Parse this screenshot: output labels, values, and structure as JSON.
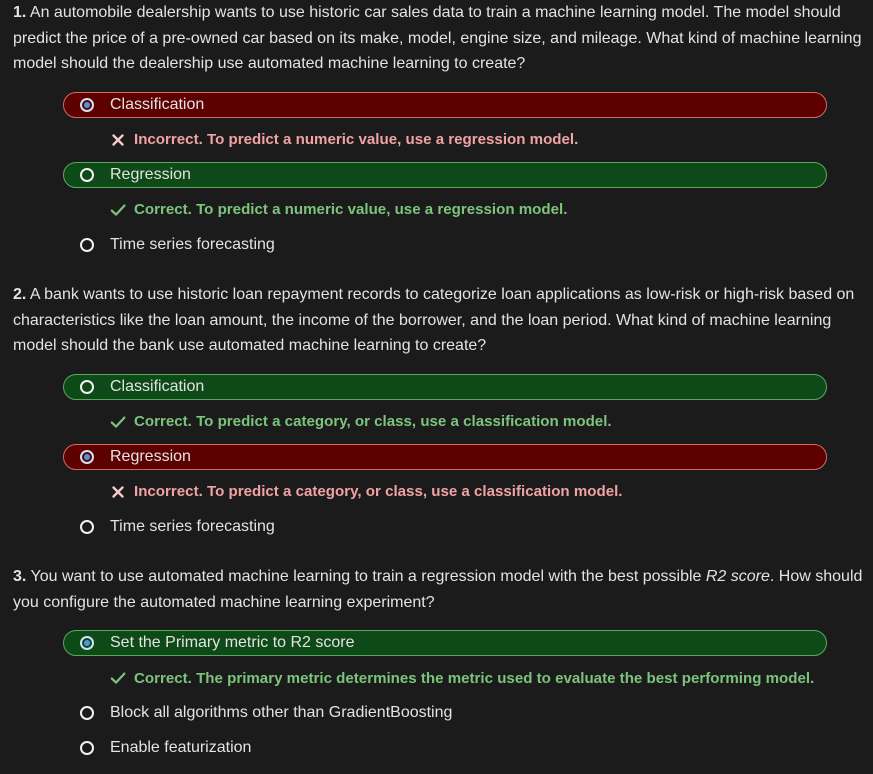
{
  "theme": {
    "page_bg": "#1b1b1b",
    "text": "#e3e3e3",
    "correct_fill": "#0d4a17",
    "correct_border": "#5aa85e",
    "correct_text": "#7cc47c",
    "incorrect_fill": "#5c0000",
    "incorrect_border": "#d06868",
    "incorrect_text": "#f1a3a3",
    "incorrect_icon": "#f6c9c9",
    "radio_ring": "#f2f2f2",
    "radio_selected_ring": "#cfe3f8",
    "radio_selected_dot": "#4e97e0"
  },
  "questions": [
    {
      "number": "1.",
      "text": "An automobile dealership wants to use historic car sales data to train a machine learning model. The model should predict the price of a pre-owned car based on its make, model, engine size, and mileage. What kind of machine learning model should the dealership use automated machine learning to create?",
      "choices": [
        {
          "label": "Classification",
          "selected": true,
          "result": "incorrect",
          "feedback_icon": "x-mark-icon",
          "feedback": "Incorrect. To predict a numeric value, use a regression model."
        },
        {
          "label": "Regression",
          "selected": false,
          "result": "correct",
          "feedback_icon": "checkmark-icon",
          "feedback": "Correct. To predict a numeric value, use a regression model."
        },
        {
          "label": "Time series forecasting",
          "selected": false
        }
      ]
    },
    {
      "number": "2.",
      "text": "A bank wants to use historic loan repayment records to categorize loan applications as low-risk or high-risk based on characteristics like the loan amount, the income of the borrower, and the loan period. What kind of machine learning model should the bank use automated machine learning to create?",
      "choices": [
        {
          "label": "Classification",
          "selected": false,
          "result": "correct",
          "feedback_icon": "checkmark-icon",
          "feedback": "Correct. To predict a category, or class, use a classification model."
        },
        {
          "label": "Regression",
          "selected": true,
          "result": "incorrect",
          "feedback_icon": "x-mark-icon",
          "feedback": "Incorrect. To predict a category, or class, use a classification model."
        },
        {
          "label": "Time series forecasting",
          "selected": false
        }
      ]
    },
    {
      "number": "3.",
      "text_before": "You want to use automated machine learning to train a regression model with the best possible ",
      "text_emphasis": "R2 score",
      "text_after": ". How should you configure the automated machine learning experiment?",
      "choices": [
        {
          "label": "Set the Primary metric to R2 score",
          "selected": true,
          "result": "correct",
          "feedback_icon": "checkmark-icon",
          "feedback": "Correct. The primary metric determines the metric used to evaluate the best performing model."
        },
        {
          "label": "Block all algorithms other than GradientBoosting",
          "selected": false
        },
        {
          "label": "Enable featurization",
          "selected": false
        }
      ]
    }
  ]
}
